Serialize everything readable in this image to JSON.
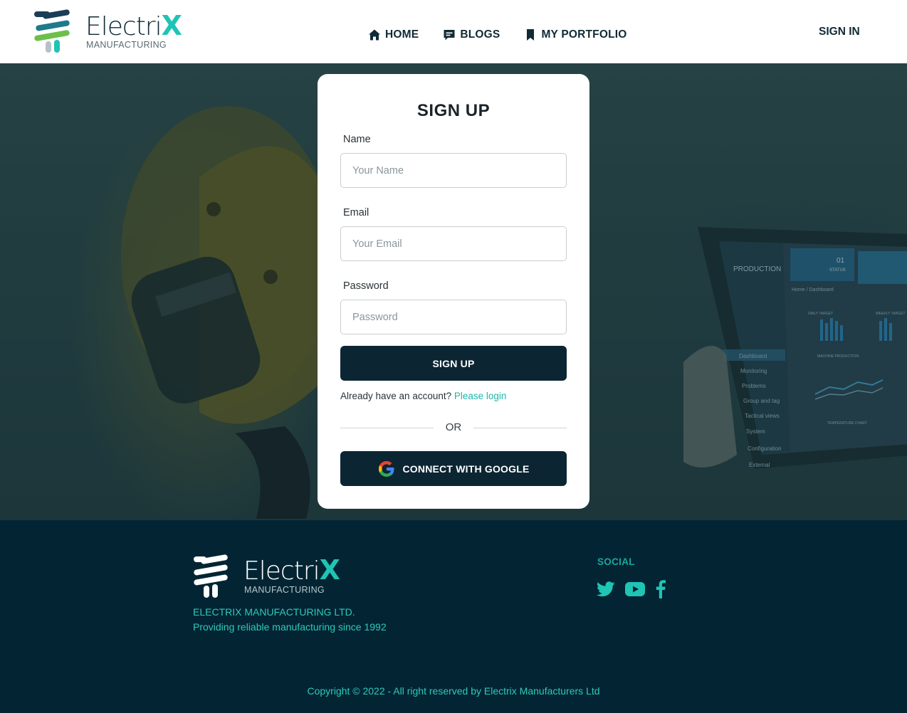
{
  "brand": {
    "name_main": "Electri",
    "name_accent": "X",
    "subtitle": "MANUFACTURING"
  },
  "nav": {
    "items": [
      {
        "label": "HOME",
        "icon": "home-icon"
      },
      {
        "label": "BLOGS",
        "icon": "chat-icon"
      },
      {
        "label": "MY PORTFOLIO",
        "icon": "bookmark-icon"
      }
    ],
    "signin": "SIGN IN"
  },
  "form": {
    "title": "SIGN UP",
    "name_label": "Name",
    "name_placeholder": "Your Name",
    "email_label": "Email",
    "email_placeholder": "Your Email",
    "password_label": "Password",
    "password_placeholder": "Password",
    "submit": "SIGN UP",
    "have_account": "Already have an account?",
    "login_link": "Please login",
    "or": "OR",
    "google": "CONNECT WITH GOOGLE"
  },
  "tablet": {
    "header": "PRODUCTION",
    "menu": [
      "Dashboard",
      "Monitoring",
      "Problems",
      "Group and tag",
      "Tactical views",
      "System",
      "Configuration",
      "External"
    ],
    "stat_value": "01",
    "stat_label": "STATUS",
    "breadcrumb": "Home / Dashboard",
    "panel_titles": [
      "DAILY TARGET",
      "WEEKLY TARGET",
      "MACHINE PRODUCTION",
      "TEMPERATURE CHART"
    ]
  },
  "footer": {
    "company": "ELECTRIX MANUFACTURING LTD.",
    "tagline": "Providing reliable manufacturing since 1992",
    "social_title": "SOCIAL",
    "copyright": "Copyright © 2022 - All right reserved by Electrix Manufacturers Ltd"
  },
  "colors": {
    "accent": "#20c4b4",
    "dark": "#0c2533",
    "footer_bg": "#032533"
  }
}
